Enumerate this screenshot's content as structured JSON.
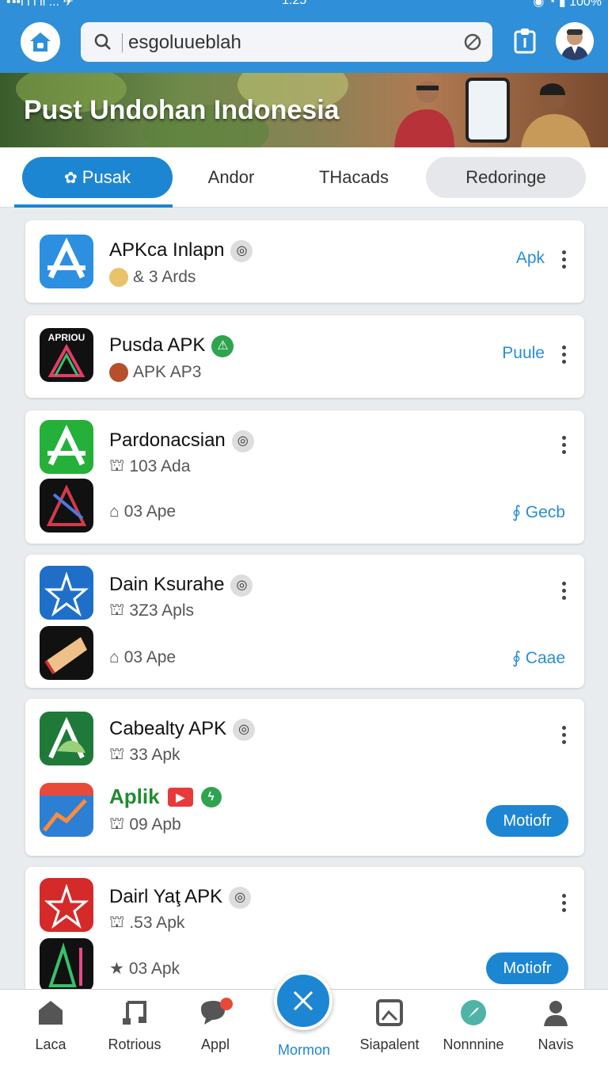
{
  "status": {
    "left": "• ••l l l  ll ... ✈",
    "center": "1:25",
    "right": "◉ ◔ ▮ 100%"
  },
  "search": {
    "value": "esgoluueblah"
  },
  "banner": {
    "title": "Pust Undohan Indonesia"
  },
  "tabs": [
    {
      "label": "Pusak"
    },
    {
      "label": "Andor"
    },
    {
      "label": "THacads"
    },
    {
      "label": "Redoringe"
    }
  ],
  "cards": [
    {
      "name": "APKca Inlapn",
      "sub": "& 3 Ards",
      "action": "Apk"
    },
    {
      "name": "Pusda APK",
      "sub": "APK AP3",
      "action": "Puule"
    },
    {
      "name": "Pardonacsian",
      "sub": "103 Ada",
      "sub2": "03 Ape",
      "action": "Gecb"
    },
    {
      "name": "Dain Ksurahe",
      "sub": "3Z3 Apls",
      "sub2": "03 Ape",
      "action": "Caae"
    },
    {
      "name": "Cabealty APK",
      "sub": "33 Apk",
      "promo": "Aplik",
      "sub2": "09 Apb",
      "action": "Motiofr"
    },
    {
      "name": "Dairl Yaţ APK",
      "sub": ".53 Apk",
      "sub2": "03 Apk",
      "action": "Motiofr"
    }
  ],
  "nav": [
    {
      "label": "Laca"
    },
    {
      "label": "Rotrious"
    },
    {
      "label": "Appl"
    },
    {
      "label": "Mormon"
    },
    {
      "label": "Siapalent"
    },
    {
      "label": "Nonnnine"
    },
    {
      "label": "Navis"
    }
  ],
  "colors": {
    "primary": "#1d86d3",
    "topbar": "#2f8fd8",
    "promo_green": "#1f8c2f"
  }
}
